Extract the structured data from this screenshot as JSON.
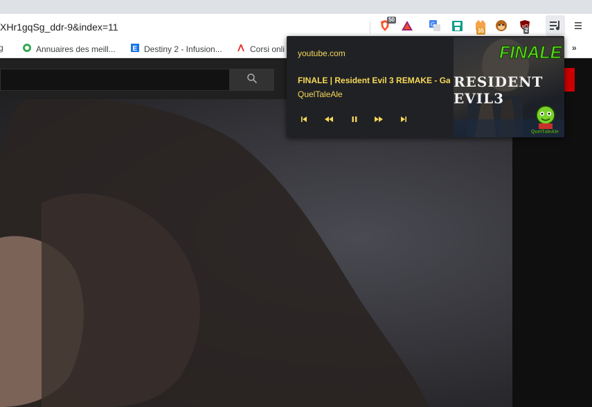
{
  "browser": {
    "url": "XHr1gqSg_ddr-9&index=11",
    "extensions": [
      {
        "name": "brave-shields",
        "badge": "50"
      },
      {
        "name": "brave-rewards",
        "badge": ""
      },
      {
        "name": "google-translate",
        "badge": ""
      },
      {
        "name": "save-to-drive",
        "badge": ""
      },
      {
        "name": "tampermonkey",
        "badge": "35"
      },
      {
        "name": "monkey-extension",
        "badge": ""
      },
      {
        "name": "ublock-origin",
        "badge": "2"
      },
      {
        "name": "media-controls",
        "badge": ""
      }
    ],
    "menu_icon": "kebab-menu-icon"
  },
  "bookmarks": [
    {
      "label": "g",
      "icon": "favicon-icon"
    },
    {
      "label": "Annuaires des meill...",
      "icon": "green-favicon-icon"
    },
    {
      "label": "Destiny 2 - Infusion...",
      "icon": "blue-e-favicon-icon"
    },
    {
      "label": "Corsi onli",
      "icon": "red-favicon-icon"
    }
  ],
  "bookmarks_more": "»",
  "media_popup": {
    "site": "youtube.com",
    "title": "FINALE | Resident Evil 3 REMAKE - Ga...",
    "channel": "QuelTaleAle",
    "thumbnail_text": {
      "finale": "FINALE",
      "game": "RESIDENT EVIL3",
      "logo": "QuelTaleAle"
    },
    "accent": "#f6d95a"
  }
}
